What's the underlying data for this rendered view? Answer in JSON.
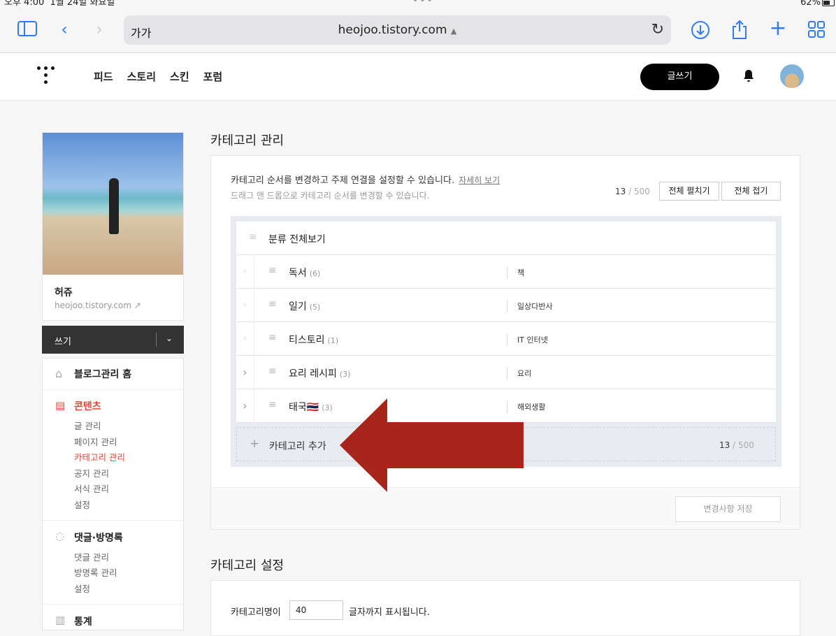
{
  "status": {
    "time": "오후 4:00",
    "date": "1월 24일 화요일",
    "battery": "62%"
  },
  "browser": {
    "text_size": "가가",
    "host": "heojoo.tistory.com"
  },
  "header": {
    "nav": [
      "피드",
      "스토리",
      "스킨",
      "포럼"
    ],
    "write_label": "글쓰기"
  },
  "sidebar": {
    "blog_name": "허쥬",
    "blog_url": "heojoo.tistory.com",
    "write_label": "쓰기",
    "home_label": "블로그관리 홈",
    "content_label": "콘텐츠",
    "content_items": [
      "글 관리",
      "페이지 관리",
      "카테고리 관리",
      "공지 관리",
      "서식 관리",
      "설정"
    ],
    "comments_label": "댓글·방명록",
    "comment_items": [
      "댓글 관리",
      "방명록 관리",
      "설정"
    ],
    "stats_label": "통계"
  },
  "main": {
    "title": "카테고리 관리",
    "desc1": "카테고리 순서를 변경하고 주제 연결을 설정할 수 있습니다.",
    "more_link": "자세히 보기",
    "desc2": "드래그 앤 드롭으로 카테고리 순서를 변경할 수 있습니다.",
    "count": "13",
    "count_max": " / 500",
    "expand_all": "전체 펼치기",
    "collapse_all": "전체 접기",
    "all_label": "분류 전체보기",
    "categories": [
      {
        "arrow": "◦",
        "name": "독서",
        "count": "(6)",
        "topic": "책"
      },
      {
        "arrow": "◦",
        "name": "일기",
        "count": "(5)",
        "topic": "일상다반사"
      },
      {
        "arrow": "◦",
        "name": "티스토리",
        "count": "(1)",
        "topic": "IT 인터넷"
      },
      {
        "arrow": "›",
        "name": "요리 레시피",
        "count": "(3)",
        "topic": "요리"
      },
      {
        "arrow": "›",
        "name": "태국🇹🇭",
        "count": "(3)",
        "topic": "해외생활"
      }
    ],
    "add_label": "카테고리 추가",
    "save_label": "변경사항 저장",
    "settings_title": "카테고리 설정",
    "name_length_label": "카테고리명이",
    "name_length_value": "40",
    "name_length_suffix": "글자까지 표시됩니다."
  },
  "colors": {
    "accent": "#e24436",
    "annotation_arrow": "#a8251c"
  }
}
